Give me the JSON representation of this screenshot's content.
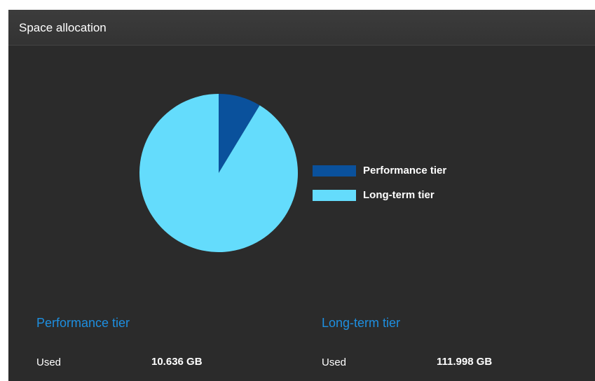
{
  "panel": {
    "title": "Space allocation"
  },
  "chart_data": {
    "type": "pie",
    "title": "",
    "categories": [
      "Performance tier",
      "Long-term tier"
    ],
    "values": [
      10.636,
      111.998
    ],
    "colors": [
      "#0a519c",
      "#64dcfc"
    ],
    "legend": {
      "placement": "right",
      "entries": [
        "Performance tier",
        "Long-term tier"
      ]
    }
  },
  "tiers": [
    {
      "title": "Performance tier",
      "used_label": "Used",
      "used_value": "10.636 GB"
    },
    {
      "title": "Long-term tier",
      "used_label": "Used",
      "used_value": "111.998 GB"
    }
  ],
  "colors": {
    "panel_bg": "#2b2b2b",
    "accent_blue": "#1e8fe0"
  }
}
